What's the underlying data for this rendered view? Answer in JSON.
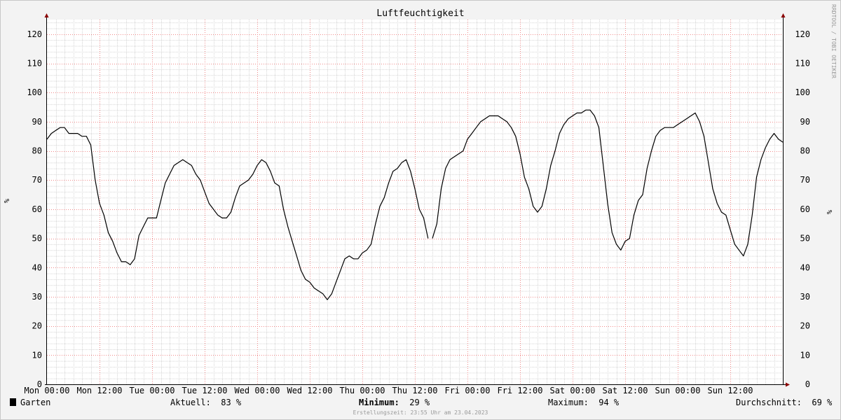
{
  "chart_data": {
    "type": "line",
    "title": "Luftfeuchtigkeit",
    "ylabel_left": "%",
    "ylabel_right": "%",
    "ylim": [
      0,
      125
    ],
    "y_ticks": [
      0,
      10,
      20,
      30,
      40,
      50,
      60,
      70,
      80,
      90,
      100,
      110,
      120
    ],
    "x_range_hours": [
      0,
      168
    ],
    "x_ticks": [
      {
        "h": 0,
        "label": "Mon 00:00"
      },
      {
        "h": 12,
        "label": "Mon 12:00"
      },
      {
        "h": 24,
        "label": "Tue 00:00"
      },
      {
        "h": 36,
        "label": "Tue 12:00"
      },
      {
        "h": 48,
        "label": "Wed 00:00"
      },
      {
        "h": 60,
        "label": "Wed 12:00"
      },
      {
        "h": 72,
        "label": "Thu 00:00"
      },
      {
        "h": 84,
        "label": "Thu 12:00"
      },
      {
        "h": 96,
        "label": "Fri 00:00"
      },
      {
        "h": 108,
        "label": "Fri 12:00"
      },
      {
        "h": 120,
        "label": "Sat 00:00"
      },
      {
        "h": 132,
        "label": "Sat 12:00"
      },
      {
        "h": 144,
        "label": "Sun 00:00"
      },
      {
        "h": 156,
        "label": "Sun 12:00"
      }
    ],
    "grid": true,
    "side_label": "RRDTOOL / TOBI OETIKER",
    "series": [
      {
        "name": "Garten",
        "color": "#000000",
        "segments": [
          [
            [
              0,
              84
            ],
            [
              1,
              86
            ],
            [
              2,
              87
            ],
            [
              3,
              88
            ],
            [
              4,
              88
            ],
            [
              5,
              86
            ],
            [
              6,
              86
            ],
            [
              7,
              86
            ],
            [
              8,
              85
            ],
            [
              9,
              85
            ],
            [
              10,
              82
            ],
            [
              11,
              70
            ],
            [
              12,
              62
            ],
            [
              13,
              58
            ],
            [
              14,
              52
            ],
            [
              15,
              49
            ],
            [
              16,
              45
            ],
            [
              17,
              42
            ],
            [
              18,
              42
            ],
            [
              19,
              41
            ],
            [
              20,
              43
            ],
            [
              21,
              51
            ],
            [
              22,
              54
            ],
            [
              23,
              57
            ],
            [
              24,
              57
            ],
            [
              25,
              57
            ],
            [
              26,
              63
            ],
            [
              27,
              69
            ],
            [
              28,
              72
            ],
            [
              29,
              75
            ],
            [
              30,
              76
            ],
            [
              31,
              77
            ],
            [
              32,
              76
            ],
            [
              33,
              75
            ],
            [
              34,
              72
            ],
            [
              35,
              70
            ],
            [
              36,
              66
            ],
            [
              37,
              62
            ],
            [
              38,
              60
            ],
            [
              39,
              58
            ],
            [
              40,
              57
            ],
            [
              41,
              57
            ],
            [
              42,
              59
            ],
            [
              43,
              64
            ],
            [
              44,
              68
            ],
            [
              45,
              69
            ],
            [
              46,
              70
            ],
            [
              47,
              72
            ],
            [
              48,
              75
            ],
            [
              49,
              77
            ],
            [
              50,
              76
            ],
            [
              51,
              73
            ],
            [
              52,
              69
            ],
            [
              53,
              68
            ],
            [
              54,
              60
            ],
            [
              55,
              54
            ],
            [
              56,
              49
            ],
            [
              57,
              44
            ],
            [
              58,
              39
            ],
            [
              59,
              36
            ],
            [
              60,
              35
            ],
            [
              61,
              33
            ],
            [
              62,
              32
            ],
            [
              63,
              31
            ],
            [
              64,
              29
            ],
            [
              65,
              31
            ],
            [
              66,
              35
            ],
            [
              67,
              39
            ],
            [
              68,
              43
            ],
            [
              69,
              44
            ],
            [
              70,
              43
            ],
            [
              71,
              43
            ],
            [
              72,
              45
            ],
            [
              73,
              46
            ],
            [
              74,
              48
            ],
            [
              75,
              55
            ],
            [
              76,
              61
            ],
            [
              77,
              64
            ],
            [
              78,
              69
            ],
            [
              79,
              73
            ],
            [
              80,
              74
            ],
            [
              81,
              76
            ],
            [
              82,
              77
            ],
            [
              83,
              73
            ],
            [
              84,
              67
            ],
            [
              85,
              60
            ],
            [
              86,
              57
            ],
            [
              87,
              50
            ]
          ],
          [
            [
              88,
              50
            ],
            [
              89,
              55
            ],
            [
              90,
              67
            ],
            [
              91,
              74
            ],
            [
              92,
              77
            ],
            [
              93,
              78
            ],
            [
              94,
              79
            ],
            [
              95,
              80
            ],
            [
              96,
              84
            ],
            [
              97,
              86
            ],
            [
              98,
              88
            ],
            [
              99,
              90
            ],
            [
              100,
              91
            ],
            [
              101,
              92
            ],
            [
              102,
              92
            ],
            [
              103,
              92
            ],
            [
              104,
              91
            ],
            [
              105,
              90
            ],
            [
              106,
              88
            ],
            [
              107,
              85
            ],
            [
              108,
              79
            ],
            [
              109,
              71
            ],
            [
              110,
              67
            ],
            [
              111,
              61
            ],
            [
              112,
              59
            ],
            [
              113,
              61
            ],
            [
              114,
              67
            ],
            [
              115,
              75
            ],
            [
              116,
              80
            ],
            [
              117,
              86
            ],
            [
              118,
              89
            ],
            [
              119,
              91
            ],
            [
              120,
              92
            ],
            [
              121,
              93
            ],
            [
              122,
              93
            ],
            [
              123,
              94
            ],
            [
              124,
              94
            ],
            [
              125,
              92
            ],
            [
              126,
              88
            ],
            [
              127,
              75
            ],
            [
              128,
              62
            ],
            [
              129,
              52
            ],
            [
              130,
              48
            ],
            [
              131,
              46
            ],
            [
              132,
              49
            ],
            [
              133,
              50
            ],
            [
              134,
              58
            ],
            [
              135,
              63
            ],
            [
              136,
              65
            ],
            [
              137,
              74
            ],
            [
              138,
              80
            ],
            [
              139,
              85
            ],
            [
              140,
              87
            ],
            [
              141,
              88
            ],
            [
              142,
              88
            ],
            [
              143,
              88
            ],
            [
              144,
              89
            ],
            [
              145,
              90
            ],
            [
              146,
              91
            ],
            [
              147,
              92
            ],
            [
              148,
              93
            ],
            [
              149,
              90
            ],
            [
              150,
              85
            ],
            [
              151,
              76
            ],
            [
              152,
              67
            ],
            [
              153,
              62
            ],
            [
              154,
              59
            ],
            [
              155,
              58
            ],
            [
              156,
              53
            ],
            [
              157,
              48
            ],
            [
              158,
              46
            ],
            [
              159,
              44
            ],
            [
              160,
              48
            ],
            [
              161,
              58
            ],
            [
              162,
              71
            ],
            [
              163,
              77
            ],
            [
              164,
              81
            ],
            [
              165,
              84
            ],
            [
              166,
              86
            ],
            [
              167,
              84
            ],
            [
              168,
              83
            ]
          ]
        ]
      }
    ]
  },
  "legend": {
    "series_name": "Garten",
    "current_label": "Aktuell:",
    "current_value": "83 %",
    "min_label": "Minimum:",
    "min_value": "29 %",
    "max_label": "Maximum:",
    "max_value": "94 %",
    "avg_label": "Durchschnitt:",
    "avg_value": "69 %"
  },
  "footer": {
    "timestamp": "Erstellungszeit: 23:55 Uhr am 23.04.2023"
  }
}
